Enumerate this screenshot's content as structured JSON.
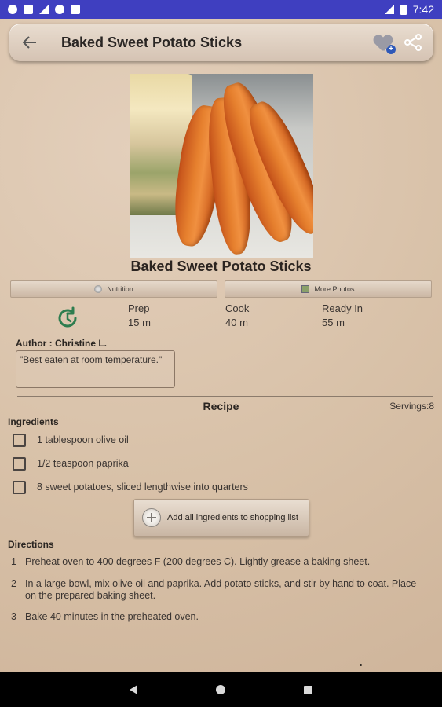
{
  "status_bar": {
    "time": "7:42",
    "icons_left": [
      "settings-icon",
      "notification-icon",
      "wifi-off-icon",
      "circle-icon",
      "sd-card-icon"
    ],
    "icons_right": [
      "signal-icon",
      "battery-icon"
    ]
  },
  "toolbar": {
    "title": "Baked Sweet Potato Sticks",
    "back_icon": "arrow-left-icon",
    "favorite_icon": "heart-add-icon",
    "share_icon": "share-icon"
  },
  "recipe": {
    "title": "Baked Sweet Potato Sticks",
    "tabs": [
      {
        "label": "Nutrition",
        "icon": "nutrition-icon"
      },
      {
        "label": "More Photos",
        "icon": "photos-icon"
      }
    ],
    "times": [
      {
        "label": "Prep",
        "value": "15 m"
      },
      {
        "label": "Cook",
        "value": "40 m"
      },
      {
        "label": "Ready In",
        "value": "55 m"
      }
    ],
    "author": "Author : Christine L.",
    "quote": "\"Best eaten at room temperature.\"",
    "section_title": "Recipe",
    "servings": "Servings:8",
    "ingredients_label": "Ingredients",
    "ingredients": [
      "1 tablespoon olive oil",
      "1/2 teaspoon paprika",
      "8 sweet potatoes, sliced lengthwise into quarters"
    ],
    "shopping_button": "Add all ingredients to shopping list",
    "directions_label": "Directions",
    "directions": [
      {
        "num": "1",
        "text": "Preheat oven to 400 degrees F (200 degrees C). Lightly grease a baking sheet."
      },
      {
        "num": "2",
        "text": "In a large bowl, mix olive oil and paprika. Add potato sticks, and stir by hand to coat. Place on the prepared baking sheet."
      },
      {
        "num": "3",
        "text": "Bake 40 minutes in the preheated oven."
      }
    ]
  },
  "colors": {
    "status_bar": "#3f3fc0",
    "background": "#d8c2ab",
    "accent_green": "#2e7d4f"
  }
}
